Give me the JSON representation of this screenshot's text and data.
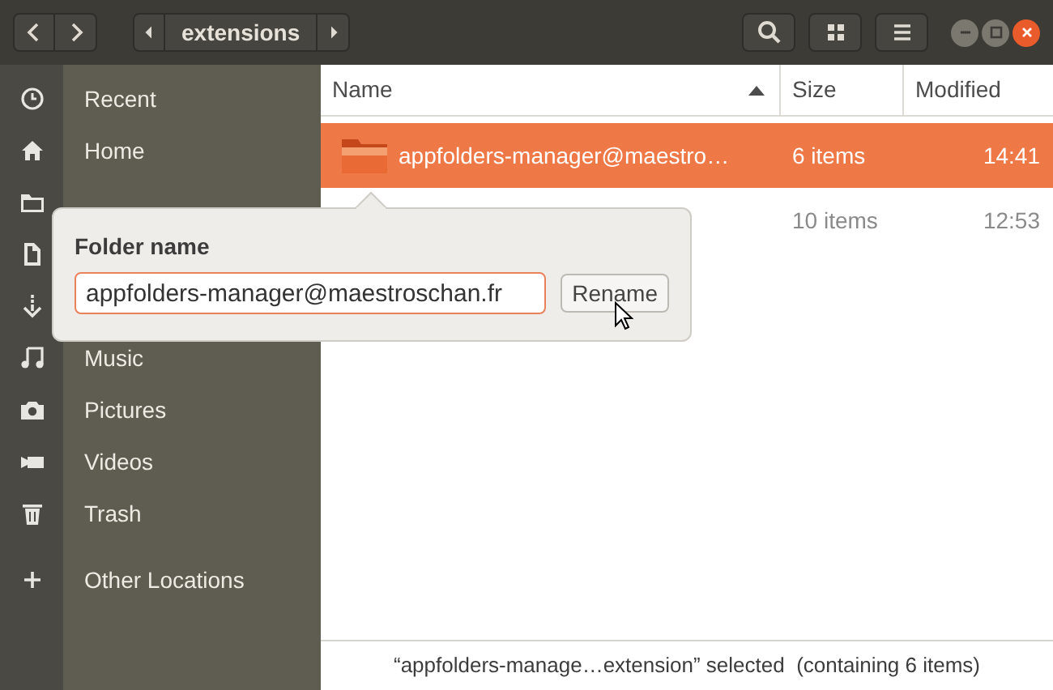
{
  "header": {
    "path": "extensions"
  },
  "sidebar": {
    "items": [
      {
        "kind": "place",
        "label": "Recent"
      },
      {
        "kind": "place",
        "label": "Home"
      },
      {
        "kind": "covered"
      },
      {
        "kind": "covered"
      },
      {
        "kind": "covered"
      },
      {
        "kind": "place",
        "label": "Music"
      },
      {
        "kind": "place",
        "label": "Pictures"
      },
      {
        "kind": "place",
        "label": "Videos"
      },
      {
        "kind": "place",
        "label": "Trash"
      },
      {
        "kind": "place",
        "label": "Other Locations"
      }
    ]
  },
  "table": {
    "columns": [
      {
        "label": "Name",
        "sorted": true
      },
      {
        "label": "Size"
      },
      {
        "label": "Modified"
      }
    ],
    "rows": [
      {
        "name": "appfolders-manager@maestro…",
        "size": "6 items",
        "modified": "14:41",
        "selected": true
      },
      {
        "size": "10 items",
        "modified": "12:53",
        "selected": false
      }
    ]
  },
  "rename_popover": {
    "title": "Folder name",
    "value": "appfolders-manager@maestroschan.fr",
    "button": "Rename"
  },
  "status_bar": "“appfolders-manage…extension” selected  (containing 6 items)"
}
